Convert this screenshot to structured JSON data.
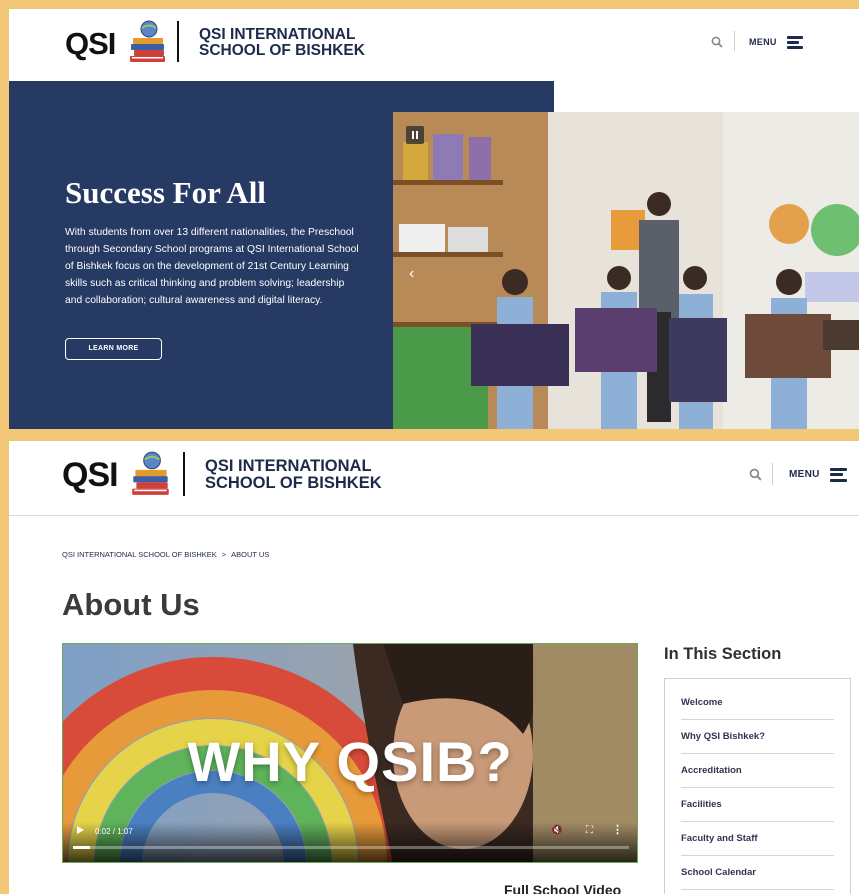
{
  "brand": {
    "logo_text": "QSI",
    "school_line1": "QSI INTERNATIONAL",
    "school_line2": "SCHOOL OF BISHKEK"
  },
  "header": {
    "menu_label": "MENU"
  },
  "hero": {
    "title": "Success For All",
    "body": "With students from over 13 different nationalities, the Preschool through Secondary School programs at QSI International School of Bishkek focus on the development of 21st Century Learning skills such as critical thinking and problem solving; leadership and collaboration; cultural awareness and digital literacy.",
    "cta_label": "LEARN MORE"
  },
  "breadcrumb": {
    "home": "QSI INTERNATIONAL SCHOOL OF BISHKEK",
    "separator": ">",
    "current": "ABOUT US"
  },
  "page": {
    "title": "About Us"
  },
  "video": {
    "overlay_text": "WHY QSIB?",
    "time": "0:02 / 1:07",
    "progress_fraction": 0.03,
    "caption": "Full School Video"
  },
  "sidebar": {
    "title": "In This Section",
    "items": [
      {
        "label": "Welcome"
      },
      {
        "label": "Why QSI Bishkek?"
      },
      {
        "label": "Accreditation"
      },
      {
        "label": "Facilities"
      },
      {
        "label": "Faculty and Staff"
      },
      {
        "label": "School Calendar"
      }
    ]
  },
  "colors": {
    "page_bg": "#f2c778",
    "navy": "#263a63",
    "text_navy": "#1d2a4a"
  }
}
